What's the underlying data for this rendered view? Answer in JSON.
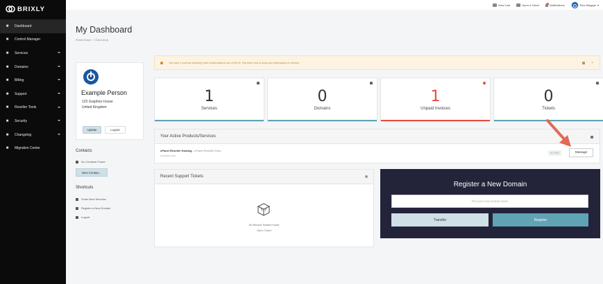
{
  "brand": {
    "name": "BRIXLY"
  },
  "sidebar": {
    "items": [
      {
        "label": "Dashboard",
        "icon": "dashboard-icon",
        "has_caret": false
      },
      {
        "label": "Control Manager",
        "icon": "control-manager-icon",
        "has_caret": false
      },
      {
        "label": "Services",
        "icon": "services-icon",
        "has_caret": true
      },
      {
        "label": "Domains",
        "icon": "domains-icon",
        "has_caret": true
      },
      {
        "label": "Billing",
        "icon": "billing-icon",
        "has_caret": true
      },
      {
        "label": "Support",
        "icon": "support-icon",
        "has_caret": true
      },
      {
        "label": "Reseller Tools",
        "icon": "reseller-tools-icon",
        "has_caret": true
      },
      {
        "label": "Security",
        "icon": "security-icon",
        "has_caret": true
      },
      {
        "label": "Changelog",
        "icon": "changelog-icon",
        "has_caret": true
      },
      {
        "label": "Migration Center",
        "icon": "migration-center-icon",
        "has_caret": false
      }
    ]
  },
  "topbar": {
    "view_cart": "View Cart",
    "open_ticket": "Open a Ticket",
    "notifications": "Notifications",
    "user": "Rica Magaye"
  },
  "header": {
    "title": "My Dashboard",
    "breadcrumb": [
      "Portal Home",
      "/",
      "Client Area"
    ]
  },
  "profile": {
    "name": "Example Person",
    "address_line1": "123 Graphics house",
    "address_line2": "United Kingdom",
    "update_label": "Update",
    "logout_label": "Logout"
  },
  "contacts": {
    "heading": "Contacts",
    "empty": "No Contacts Found",
    "new_label": "New Contact..."
  },
  "shortcuts": {
    "heading": "Shortcuts",
    "items": [
      "Order New Services",
      "Register a New Domain",
      "Logout"
    ]
  },
  "alert": {
    "text": "You have 1 overdue invoice(s) with a total balance due of £0.00. Pay them now to avoid any interruptions in service."
  },
  "stats": [
    {
      "value": "1",
      "label": "Services",
      "color": "#5fa3b5"
    },
    {
      "value": "0",
      "label": "Domains",
      "color": "#5fa3b5"
    },
    {
      "value": "1",
      "label": "Unpaid Invoices",
      "color": "#e74c3c"
    },
    {
      "value": "0",
      "label": "Tickets",
      "color": "#5fa3b5"
    }
  ],
  "products": {
    "heading": "Your Active Products/Services",
    "name": "cPanel Reseller Hosting",
    "name_suffix": " - cPanel Reseller Entry",
    "domain": "example.com",
    "status": "ACTIVE",
    "manage_label": "Manage"
  },
  "tickets": {
    "heading": "Recent Support Tickets",
    "empty": "No Recent Tickets Found",
    "open_label": "Open Ticket"
  },
  "domain_register": {
    "title": "Register a New Domain",
    "placeholder": "Find your new domain name",
    "transfer_label": "Transfer",
    "register_label": "Register"
  },
  "colors": {
    "sidebar_bg": "#0b0b0b",
    "accent": "#5fa3b5",
    "danger": "#e74c3c",
    "domain_panel_bg": "#23233a",
    "annotation_arrow": "#e06a56"
  }
}
